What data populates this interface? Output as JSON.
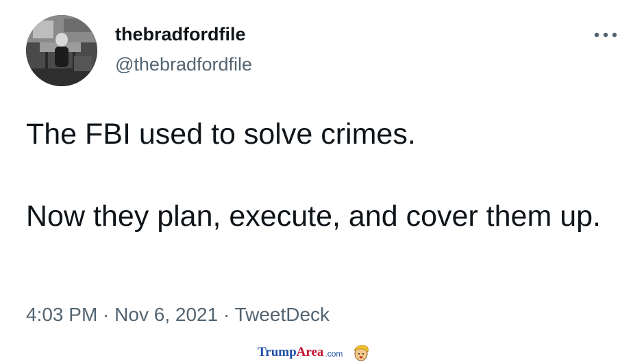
{
  "tweet": {
    "display_name": "thebradfordfile",
    "handle": "@thebradfordfile",
    "body": [
      "The FBI used to solve crimes.",
      "Now they plan, execute, and cover them up."
    ],
    "meta": {
      "time": "4:03 PM",
      "separator": "·",
      "date": "Nov 6, 2021",
      "source": "TweetDeck"
    }
  },
  "icons": {
    "more": "more-horizontal-icon",
    "avatar": "profile-photo"
  },
  "watermark": {
    "part1": "Trump",
    "part2": "Area",
    "part3": ".com"
  },
  "colors": {
    "text_primary": "#0f1419",
    "text_secondary": "#536471",
    "watermark_blue": "#1f4fa8",
    "watermark_red": "#c8102e"
  }
}
